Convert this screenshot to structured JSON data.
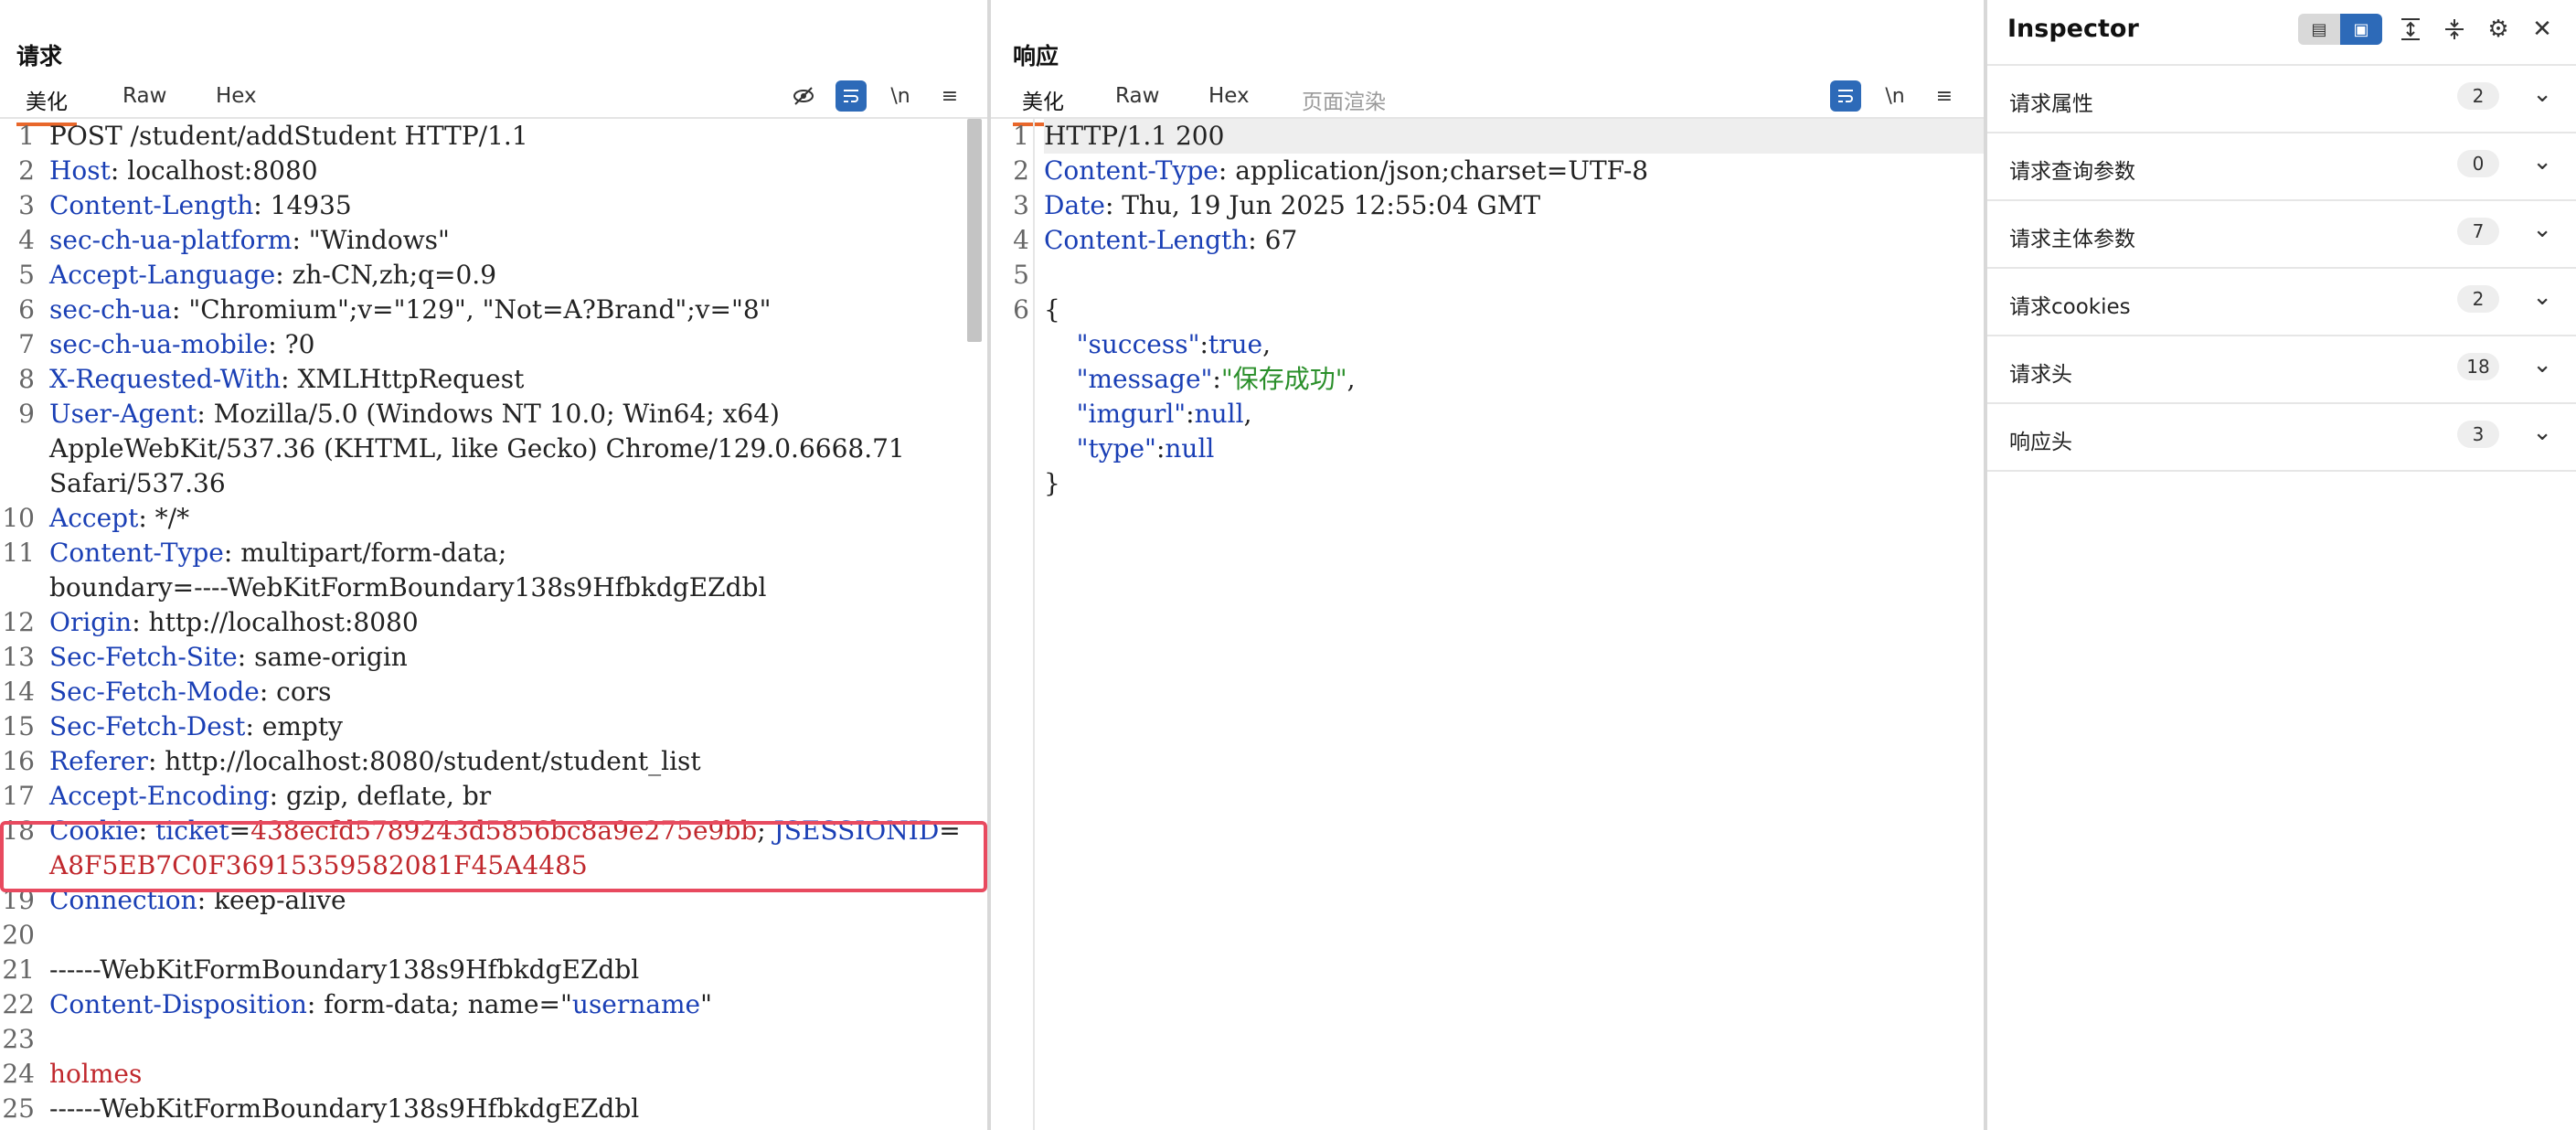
{
  "request": {
    "title": "请求",
    "tabs": [
      "美化",
      "Raw",
      "Hex"
    ],
    "lines": [
      {
        "n": "1",
        "parts": [
          [
            "v",
            "POST /student/addStudent HTTP/1.1"
          ]
        ]
      },
      {
        "n": "2",
        "parts": [
          [
            "k",
            "Host"
          ],
          [
            "v",
            ": localhost:8080"
          ]
        ]
      },
      {
        "n": "3",
        "parts": [
          [
            "k",
            "Content-Length"
          ],
          [
            "v",
            ": 14935"
          ]
        ]
      },
      {
        "n": "4",
        "parts": [
          [
            "k",
            "sec-ch-ua-platform"
          ],
          [
            "v",
            ": \"Windows\""
          ]
        ]
      },
      {
        "n": "5",
        "parts": [
          [
            "k",
            "Accept-Language"
          ],
          [
            "v",
            ": zh-CN,zh;q=0.9"
          ]
        ]
      },
      {
        "n": "6",
        "parts": [
          [
            "k",
            "sec-ch-ua"
          ],
          [
            "v",
            ": \"Chromium\";v=\"129\", \"Not=A?Brand\";v=\"8\""
          ]
        ]
      },
      {
        "n": "7",
        "parts": [
          [
            "k",
            "sec-ch-ua-mobile"
          ],
          [
            "v",
            ": ?0"
          ]
        ]
      },
      {
        "n": "8",
        "parts": [
          [
            "k",
            "X-Requested-With"
          ],
          [
            "v",
            ": XMLHttpRequest"
          ]
        ]
      },
      {
        "n": "9",
        "parts": [
          [
            "k",
            "User-Agent"
          ],
          [
            "v",
            ": Mozilla/5.0 (Windows NT 10.0; Win64; x64)"
          ]
        ]
      },
      {
        "n": "",
        "parts": [
          [
            "v",
            "AppleWebKit/537.36 (KHTML, like Gecko) Chrome/129.0.6668.71"
          ]
        ]
      },
      {
        "n": "",
        "parts": [
          [
            "v",
            "Safari/537.36"
          ]
        ]
      },
      {
        "n": "10",
        "parts": [
          [
            "k",
            "Accept"
          ],
          [
            "v",
            ": */*"
          ]
        ]
      },
      {
        "n": "11",
        "parts": [
          [
            "k",
            "Content-Type"
          ],
          [
            "v",
            ": multipart/form-data;"
          ]
        ]
      },
      {
        "n": "",
        "parts": [
          [
            "v",
            "boundary=----WebKitFormBoundary138s9HfbkdgEZdbl"
          ]
        ]
      },
      {
        "n": "12",
        "parts": [
          [
            "k",
            "Origin"
          ],
          [
            "v",
            ": http://localhost:8080"
          ]
        ]
      },
      {
        "n": "13",
        "parts": [
          [
            "k",
            "Sec-Fetch-Site"
          ],
          [
            "v",
            ": same-origin"
          ]
        ]
      },
      {
        "n": "14",
        "parts": [
          [
            "k",
            "Sec-Fetch-Mode"
          ],
          [
            "v",
            ": cors"
          ]
        ]
      },
      {
        "n": "15",
        "parts": [
          [
            "k",
            "Sec-Fetch-Dest"
          ],
          [
            "v",
            ": empty"
          ]
        ]
      },
      {
        "n": "16",
        "parts": [
          [
            "k",
            "Referer"
          ],
          [
            "v",
            ": http://localhost:8080/student/student_list"
          ]
        ]
      },
      {
        "n": "17",
        "parts": [
          [
            "k",
            "Accept-Encoding"
          ],
          [
            "v",
            ": gzip, deflate, br"
          ]
        ]
      },
      {
        "n": "18",
        "parts": [
          [
            "k",
            "Cookie"
          ],
          [
            "v",
            ": "
          ],
          [
            "k",
            "ticket"
          ],
          [
            "v",
            "="
          ],
          [
            "red",
            "438ecfd5789243d5856bc8a9e275e9bb"
          ],
          [
            "v",
            "; "
          ],
          [
            "k",
            "JSESSIONID"
          ],
          [
            "v",
            "="
          ]
        ]
      },
      {
        "n": "",
        "parts": [
          [
            "red",
            "A8F5EB7C0F36915359582081F45A4485"
          ]
        ]
      },
      {
        "n": "19",
        "parts": [
          [
            "k",
            "Connection"
          ],
          [
            "v",
            ": keep-alive"
          ]
        ]
      },
      {
        "n": "20",
        "parts": [
          [
            "v",
            ""
          ]
        ]
      },
      {
        "n": "21",
        "parts": [
          [
            "v",
            "------WebKitFormBoundary138s9HfbkdgEZdbl"
          ]
        ]
      },
      {
        "n": "22",
        "parts": [
          [
            "k",
            "Content-Disposition"
          ],
          [
            "v",
            ": form-data; name=\""
          ],
          [
            "k",
            "username"
          ],
          [
            "v",
            "\""
          ]
        ]
      },
      {
        "n": "23",
        "parts": [
          [
            "v",
            ""
          ]
        ]
      },
      {
        "n": "24",
        "parts": [
          [
            "red",
            "holmes"
          ]
        ]
      },
      {
        "n": "25",
        "parts": [
          [
            "v",
            "------WebKitFormBoundary138s9HfbkdgEZdbl"
          ]
        ]
      }
    ]
  },
  "response": {
    "title": "响应",
    "tabs": [
      "美化",
      "Raw",
      "Hex",
      "页面渲染"
    ],
    "lines": [
      {
        "n": "1",
        "parts": [
          [
            "v",
            "HTTP/1.1 200"
          ]
        ]
      },
      {
        "n": "2",
        "parts": [
          [
            "k",
            "Content-Type"
          ],
          [
            "v",
            ": application/json;charset=UTF-8"
          ]
        ]
      },
      {
        "n": "3",
        "parts": [
          [
            "k",
            "Date"
          ],
          [
            "v",
            ": Thu, 19 Jun 2025 12:55:04 GMT"
          ]
        ]
      },
      {
        "n": "4",
        "parts": [
          [
            "k",
            "Content-Length"
          ],
          [
            "v",
            ": 67"
          ]
        ]
      },
      {
        "n": "5",
        "parts": [
          [
            "v",
            ""
          ]
        ]
      },
      {
        "n": "6",
        "parts": [
          [
            "v",
            "{"
          ]
        ]
      },
      {
        "n": "",
        "parts": [
          [
            "v",
            "    "
          ],
          [
            "k",
            "\"success\""
          ],
          [
            "v",
            ":"
          ],
          [
            "k",
            "true"
          ],
          [
            "v",
            ","
          ]
        ]
      },
      {
        "n": "",
        "parts": [
          [
            "v",
            "    "
          ],
          [
            "k",
            "\"message\""
          ],
          [
            "v",
            ":"
          ],
          [
            "grn",
            "\"保存成功\""
          ],
          [
            "v",
            ","
          ]
        ]
      },
      {
        "n": "",
        "parts": [
          [
            "v",
            "    "
          ],
          [
            "k",
            "\"imgurl\""
          ],
          [
            "v",
            ":"
          ],
          [
            "k",
            "null"
          ],
          [
            "v",
            ","
          ]
        ]
      },
      {
        "n": "",
        "parts": [
          [
            "v",
            "    "
          ],
          [
            "k",
            "\"type\""
          ],
          [
            "v",
            ":"
          ],
          [
            "k",
            "null"
          ]
        ]
      },
      {
        "n": "",
        "parts": [
          [
            "v",
            "}"
          ]
        ]
      }
    ]
  },
  "inspector": {
    "title": "Inspector",
    "rows": [
      {
        "label": "请求属性",
        "count": "2"
      },
      {
        "label": "请求查询参数",
        "count": "0"
      },
      {
        "label": "请求主体参数",
        "count": "7"
      },
      {
        "label": "请求cookies",
        "count": "2"
      },
      {
        "label": "请求头",
        "count": "18"
      },
      {
        "label": "响应头",
        "count": "3"
      }
    ]
  },
  "icons": {
    "wrap": "wrap-icon",
    "newline": "\\n",
    "menu": "≡"
  }
}
